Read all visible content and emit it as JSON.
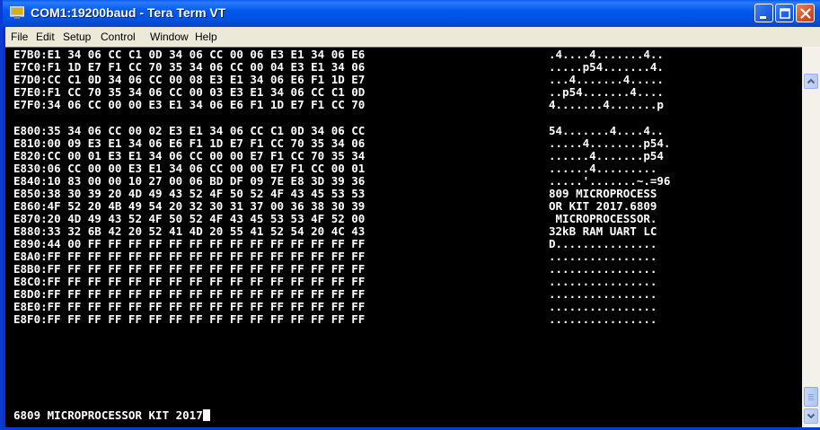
{
  "window": {
    "title": "COM1:19200baud - Tera Term VT"
  },
  "menu": [
    "File",
    "Edit",
    "Setup",
    "Control",
    "Window",
    "Help"
  ],
  "dump_block_1": [
    {
      "hex": "E7B0:E1 34 06 CC C1 0D 34 06 CC 00 06 E3 E1 34 06 E6",
      "ascii": ".4....4.......4.."
    },
    {
      "hex": "E7C0:F1 1D E7 F1 CC 70 35 34 06 CC 00 04 E3 E1 34 06",
      "ascii": ".....p54.......4."
    },
    {
      "hex": "E7D0:CC C1 0D 34 06 CC 00 08 E3 E1 34 06 E6 F1 1D E7",
      "ascii": "...4.......4....."
    },
    {
      "hex": "E7E0:F1 CC 70 35 34 06 CC 00 03 E3 E1 34 06 CC C1 0D",
      "ascii": "..p54.......4...."
    },
    {
      "hex": "E7F0:34 06 CC 00 00 E3 E1 34 06 E6 F1 1D E7 F1 CC 70",
      "ascii": "4.......4.......p"
    }
  ],
  "dump_block_2": [
    {
      "hex": "E800:35 34 06 CC 00 02 E3 E1 34 06 CC C1 0D 34 06 CC",
      "ascii": "54.......4....4.."
    },
    {
      "hex": "E810:00 09 E3 E1 34 06 E6 F1 1D E7 F1 CC 70 35 34 06",
      "ascii": ".....4........p54."
    },
    {
      "hex": "E820:CC 00 01 E3 E1 34 06 CC 00 00 E7 F1 CC 70 35 34",
      "ascii": "......4.......p54"
    },
    {
      "hex": "E830:06 CC 00 00 E3 E1 34 06 CC 00 00 E7 F1 CC 00 01",
      "ascii": "......4........."
    },
    {
      "hex": "E840:10 83 00 00 10 27 00 06 BD DF 09 7E E8 3D 39 36",
      "ascii": ".....'.......~.=96"
    },
    {
      "hex": "E850:38 30 39 20 4D 49 43 52 4F 50 52 4F 43 45 53 53",
      "ascii": "809 MICROPROCESS"
    },
    {
      "hex": "E860:4F 52 20 4B 49 54 20 32 30 31 37 00 36 38 30 39",
      "ascii": "OR KIT 2017.6809"
    },
    {
      "hex": "E870:20 4D 49 43 52 4F 50 52 4F 43 45 53 53 4F 52 00",
      "ascii": " MICROPROCESSOR."
    },
    {
      "hex": "E880:33 32 6B 42 20 52 41 4D 20 55 41 52 54 20 4C 43",
      "ascii": "32kB RAM UART LC"
    },
    {
      "hex": "E890:44 00 FF FF FF FF FF FF FF FF FF FF FF FF FF FF",
      "ascii": "D..............."
    },
    {
      "hex": "E8A0:FF FF FF FF FF FF FF FF FF FF FF FF FF FF FF FF",
      "ascii": "................"
    },
    {
      "hex": "E8B0:FF FF FF FF FF FF FF FF FF FF FF FF FF FF FF FF",
      "ascii": "................"
    },
    {
      "hex": "E8C0:FF FF FF FF FF FF FF FF FF FF FF FF FF FF FF FF",
      "ascii": "................"
    },
    {
      "hex": "E8D0:FF FF FF FF FF FF FF FF FF FF FF FF FF FF FF FF",
      "ascii": "................"
    },
    {
      "hex": "E8E0:FF FF FF FF FF FF FF FF FF FF FF FF FF FF FF FF",
      "ascii": "................"
    },
    {
      "hex": "E8F0:FF FF FF FF FF FF FF FF FF FF FF FF FF FF FF FF",
      "ascii": "................"
    }
  ],
  "command_line": "6809 MICROPROCESSOR KIT 2017",
  "colors": {
    "titlebar": "#0058ee",
    "terminal_bg": "#000000",
    "terminal_fg": "#ffffff",
    "menubar": "#ece9d8",
    "close_button": "#d2502b"
  },
  "icons": [
    "teraterm-app-icon",
    "minimize-icon",
    "maximize-icon",
    "close-icon",
    "scroll-up-icon",
    "scroll-down-icon"
  ]
}
